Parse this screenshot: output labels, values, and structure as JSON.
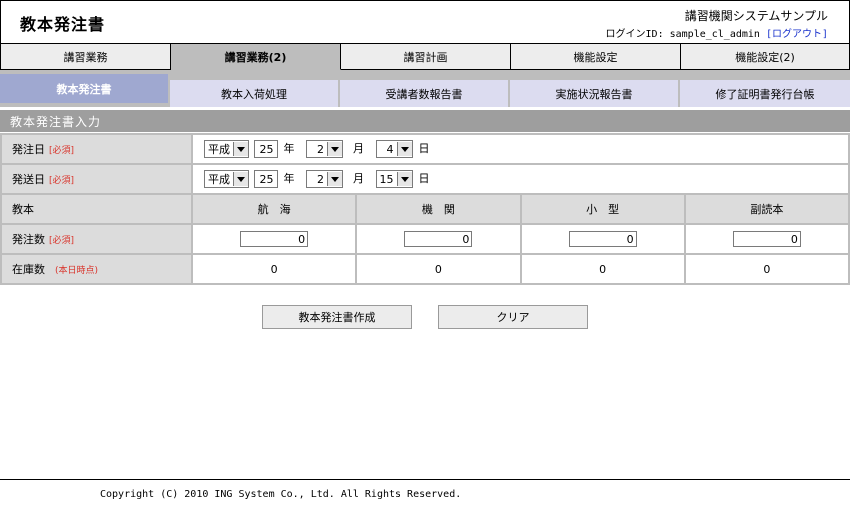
{
  "header": {
    "page_title": "教本発注書",
    "system_name": "講習機関システムサンプル",
    "login_prefix": "ログインID: sample_cl_admin",
    "logout_label": "[ログアウト]"
  },
  "main_tabs": [
    {
      "label": "講習業務"
    },
    {
      "label": "講習業務(2)"
    },
    {
      "label": "講習計画"
    },
    {
      "label": "機能設定"
    },
    {
      "label": "機能設定(2)"
    }
  ],
  "sub_tabs": [
    {
      "label": "教本発注書"
    },
    {
      "label": "教本入荷処理"
    },
    {
      "label": "受講者数報告書"
    },
    {
      "label": "実施状況報告書"
    },
    {
      "label": "修了証明書発行台帳"
    }
  ],
  "section_title": "教本発注書入力",
  "form": {
    "order_date": {
      "label": "発注日",
      "required": "[必須]",
      "era": "平成",
      "year": "25",
      "year_unit": "年",
      "month": "2",
      "month_unit": "月",
      "day": "4",
      "day_unit": "日"
    },
    "ship_date": {
      "label": "発送日",
      "required": "[必須]",
      "era": "平成",
      "year": "25",
      "year_unit": "年",
      "month": "2",
      "month_unit": "月",
      "day": "15",
      "day_unit": "日"
    },
    "textbook_label": "教本",
    "columns": [
      "航　海",
      "機　関",
      "小　型",
      "副読本"
    ],
    "order_qty": {
      "label": "発注数",
      "required": "[必須]",
      "values": [
        "0",
        "0",
        "0",
        "0"
      ]
    },
    "stock": {
      "label": "在庫数",
      "note": "(本日時点)",
      "values": [
        "0",
        "0",
        "0",
        "0"
      ]
    }
  },
  "buttons": {
    "create": "教本発注書作成",
    "clear": "クリア"
  },
  "footer": {
    "copyright": "Copyright (C) 2010 ING System Co., Ltd. All Rights Reserved."
  }
}
